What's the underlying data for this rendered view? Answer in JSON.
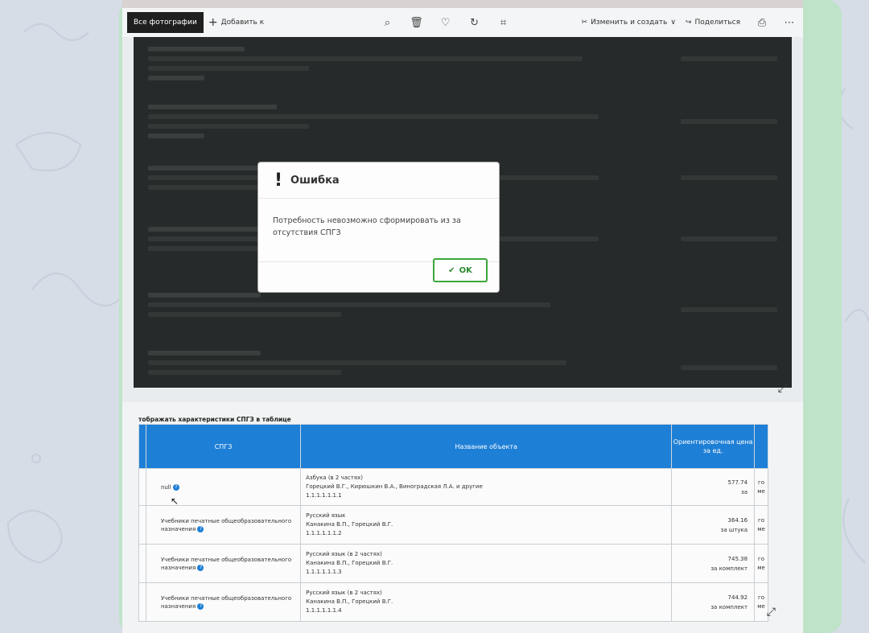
{
  "viewer": {
    "toolbar": {
      "all_photos": "Все фотографии",
      "add": "Добавить к",
      "edit_create": "Изменить и создать",
      "share": "Поделиться"
    }
  },
  "dialog": {
    "title": "Ошибка",
    "message": "Потребность невозможно сформировать из за отсутствия СПГЗ",
    "ok_label": "OK"
  },
  "page": {
    "caption": "тображать характеристики СПГЗ в таблице",
    "table": {
      "headers": [
        "СПГЗ",
        "Название объекта",
        "Ориентировочная цена за ед.",
        ""
      ],
      "rows": [
        {
          "spgz": "null",
          "name_line1": "Азбука (в 2 частях)",
          "name_line2": "Горецкий В.Г., Кирюшкин В.А., Виноградская Л.А. и другие",
          "name_line3": "1.1.1.1.1.1.1",
          "price": "577.74",
          "price_unit": "за",
          "unit": "го ме"
        },
        {
          "spgz": "Учебники печатные общеобразовательного назначения",
          "name_line1": "Русский язык",
          "name_line2": "Канакина В.П., Горецкий В.Г.",
          "name_line3": "1.1.1.1.1.1.2",
          "price": "364.16",
          "price_unit": "за штука",
          "unit": "го ме"
        },
        {
          "spgz": "Учебники печатные общеобразовательного назначения",
          "name_line1": "Русский язык (в 2 частях)",
          "name_line2": "Канакина В.П., Горецкий В.Г.",
          "name_line3": "1.1.1.1.1.1.3",
          "price": "745.38",
          "price_unit": "за комплект",
          "unit": "го ме"
        },
        {
          "spgz": "Учебники печатные общеобразовательного назначения",
          "name_line1": "Русский язык (в 2 частях)",
          "name_line2": "Канакина В.П., Горецкий В.Г.",
          "name_line3": "1.1.1.1.1.1.4",
          "price": "744.92",
          "price_unit": "за комплект",
          "unit": "го ме"
        }
      ]
    }
  }
}
